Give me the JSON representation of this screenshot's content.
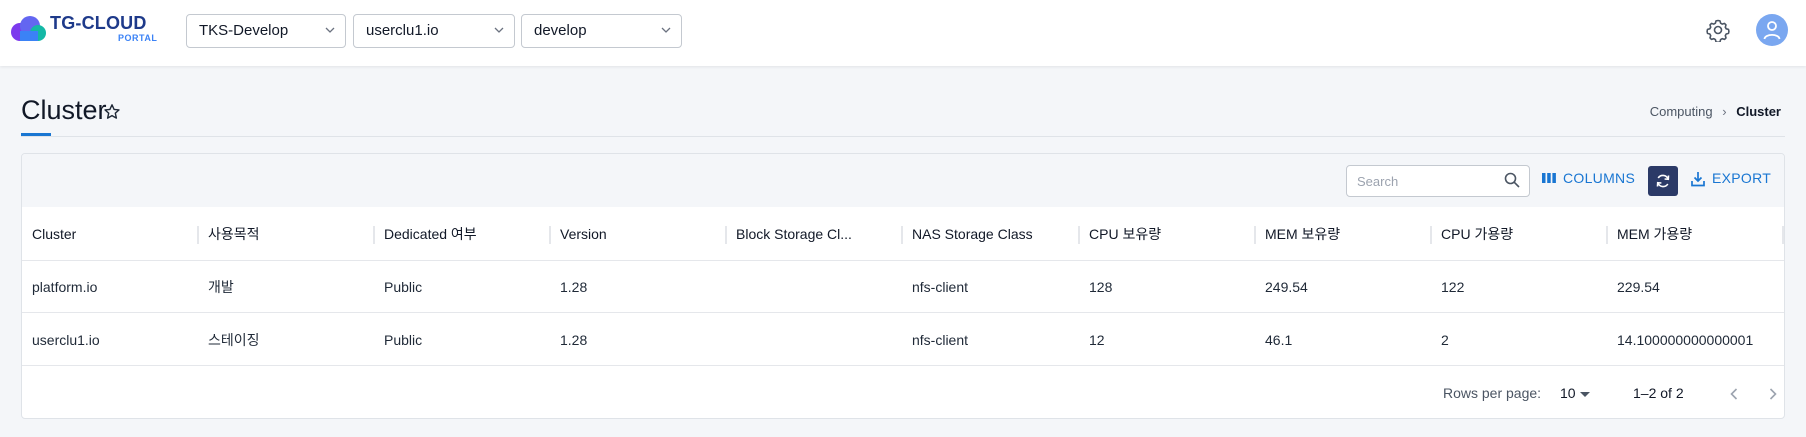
{
  "brand": {
    "name": "TG-CLOUD",
    "sub": "PORTAL"
  },
  "header": {
    "selects": [
      {
        "value": "TKS-Develop"
      },
      {
        "value": "userclu1.io"
      },
      {
        "value": "develop"
      }
    ]
  },
  "page": {
    "title": "Cluster",
    "breadcrumb": [
      "Computing",
      "Cluster"
    ]
  },
  "toolbar": {
    "search_placeholder": "Search",
    "columns_label": "COLUMNS",
    "export_label": "EXPORT"
  },
  "table": {
    "columns": [
      "Cluster",
      "사용목적",
      "Dedicated 여부",
      "Version",
      "Block Storage Cl...",
      "NAS Storage Class",
      "CPU 보유량",
      "MEM 보유량",
      "CPU 가용량",
      "MEM 가용량"
    ],
    "rows": [
      [
        "platform.io",
        "개발",
        "Public",
        "1.28",
        "",
        "nfs-client",
        "128",
        "249.54",
        "122",
        "229.54"
      ],
      [
        "userclu1.io",
        "스테이징",
        "Public",
        "1.28",
        "",
        "nfs-client",
        "12",
        "46.1",
        "2",
        "14.100000000000001"
      ]
    ]
  },
  "pagination": {
    "rows_per_page_label": "Rows per page:",
    "rows_per_page": "10",
    "range": "1–2 of 2"
  },
  "colors": {
    "accent": "#1976d2",
    "refresh_bg": "#2b3a67",
    "avatar": "#7aa7f0"
  }
}
